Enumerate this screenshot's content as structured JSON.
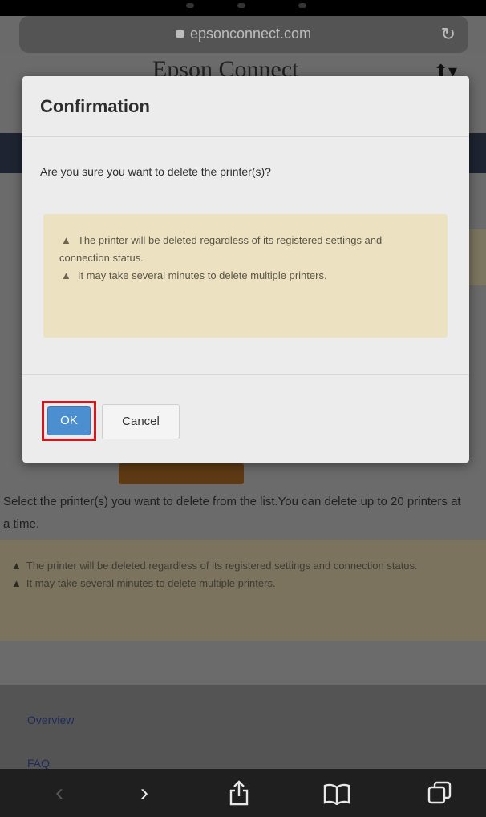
{
  "browser": {
    "url": "epsonconnect.com",
    "icons": {
      "lock": "lock-icon",
      "reload": "reload-icon"
    }
  },
  "background_page": {
    "site_title": "Epson Connect",
    "header_user_icon": "⬆▾",
    "instructions": "Select the printer(s) you want to delete from the list.You can delete up to 20 printers at a time.",
    "warning": {
      "line1": "The printer will be deleted regardless of its registered settings and connection status.",
      "line2": "It may take several minutes to delete multiple printers."
    },
    "footer_links": [
      "Overview",
      "FAQ"
    ]
  },
  "modal": {
    "title": "Confirmation",
    "question": "Are you sure you want to delete the printer(s)?",
    "warning": {
      "line1": "The printer will be deleted regardless of its registered settings and connection status.",
      "line2": "It may take several minutes to delete multiple printers."
    },
    "ok_label": "OK",
    "cancel_label": "Cancel",
    "colors": {
      "ok_button": "#4b8fd1",
      "highlight_outline": "#d9141c",
      "warning_bg": "#ece2c2"
    }
  },
  "toolbar": {
    "icons": [
      "back-icon",
      "forward-icon",
      "share-icon",
      "bookmarks-icon",
      "tabs-icon"
    ],
    "glyphs": {
      "back": "‹",
      "forward": "›",
      "share": "⬆",
      "bookmarks": "🕮",
      "tabs": "⧉"
    }
  }
}
